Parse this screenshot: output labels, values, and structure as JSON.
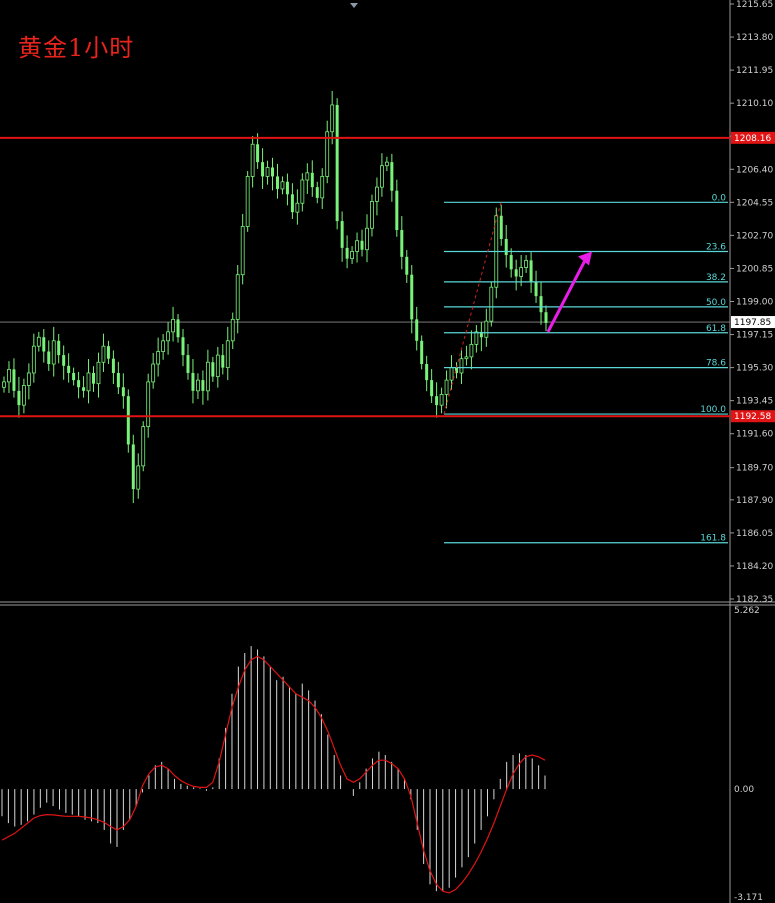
{
  "title": "黄金1小时",
  "colors": {
    "background": "#000000",
    "bull_candle": "#79f279",
    "bear_candle": "#79f279",
    "fib": "#5ad7d7",
    "support_resistance": "#e01414",
    "arrow": "#e81ee8",
    "macd_hist": "#d8d8d8",
    "signal": "#e01414",
    "axis_text": "#cfcfcf",
    "current_price_bg": "#ffffff"
  },
  "chart_data": [
    {
      "type": "candlestick",
      "title": "黄金1小时",
      "y_ticks": [
        "1215.65",
        "1213.80",
        "1211.95",
        "1210.10",
        "1208.25",
        "1206.40",
        "1204.55",
        "1202.70",
        "1200.85",
        "1199.00",
        "1197.15",
        "1195.30",
        "1193.45",
        "1191.60",
        "1189.70",
        "1187.90",
        "1186.05",
        "1184.20",
        "1182.35"
      ],
      "ylim": [
        1182.35,
        1215.65
      ],
      "horizontal_lines": [
        {
          "label": "1208.16",
          "value": 1208.16,
          "color": "red"
        },
        {
          "label": "1192.58",
          "value": 1192.58,
          "color": "red"
        }
      ],
      "current_price": {
        "label": "1197.85",
        "value": 1197.85
      },
      "fibonacci": {
        "levels": [
          {
            "label": "0.0",
            "value": 1204.55
          },
          {
            "label": "23.6",
            "value": 1201.8
          },
          {
            "label": "38.2",
            "value": 1200.1
          },
          {
            "label": "50.0",
            "value": 1198.7
          },
          {
            "label": "61.8",
            "value": 1197.25
          },
          {
            "label": "78.6",
            "value": 1195.3
          },
          {
            "label": "100.0",
            "value": 1192.7
          },
          {
            "label": "161.8",
            "value": 1185.5
          }
        ]
      },
      "arrow": {
        "from": [
          548,
          1197.3
        ],
        "to": [
          592,
          1201.8
        ],
        "direction": "up"
      },
      "closes": [
        1194.5,
        1195.2,
        1194.0,
        1193.2,
        1194.3,
        1195.0,
        1196.5,
        1197.0,
        1196.2,
        1195.5,
        1196.8,
        1196.0,
        1195.4,
        1195.0,
        1194.6,
        1194.2,
        1194.0,
        1195.0,
        1194.4,
        1195.6,
        1196.5,
        1195.8,
        1195.0,
        1194.2,
        1193.7,
        1191.0,
        1188.5,
        1189.8,
        1192.0,
        1194.5,
        1195.5,
        1196.2,
        1196.8,
        1197.3,
        1198.0,
        1197.0,
        1196.0,
        1195.0,
        1194.0,
        1194.6,
        1194.0,
        1195.6,
        1194.8,
        1196.0,
        1195.3,
        1196.8,
        1198.0,
        1200.5,
        1203.2,
        1206.0,
        1207.8,
        1206.8,
        1206.0,
        1206.5,
        1206.0,
        1205.3,
        1205.7,
        1205.0,
        1204.0,
        1204.5,
        1205.8,
        1206.2,
        1205.4,
        1204.8,
        1206.0,
        1208.5,
        1210.0,
        1203.5,
        1202.0,
        1201.4,
        1201.8,
        1202.4,
        1201.9,
        1203.1,
        1204.6,
        1205.4,
        1206.6,
        1206.8,
        1205.2,
        1203.0,
        1201.5,
        1200.5,
        1198.0,
        1196.8,
        1195.5,
        1194.6,
        1193.7,
        1193.2,
        1193.8,
        1194.6,
        1195.3,
        1195.0,
        1195.8,
        1195.9,
        1196.6,
        1197.3,
        1197.0,
        1197.9,
        1199.8,
        1203.8,
        1202.5,
        1201.6,
        1200.8,
        1200.4,
        1200.9,
        1201.3,
        1200.1,
        1199.3,
        1198.4,
        1197.8
      ]
    },
    {
      "type": "bar",
      "y_ticks": [
        "5.262",
        "0.00",
        "-3.171"
      ],
      "ylim": [
        -3.171,
        5.262
      ],
      "histogram": [
        -0.8,
        -1.0,
        -1.1,
        -1.05,
        -0.95,
        -0.75,
        -0.55,
        -0.4,
        -0.5,
        -0.6,
        -0.7,
        -0.75,
        -0.8,
        -0.9,
        -0.95,
        -1.0,
        -1.2,
        -1.6,
        -1.7,
        -1.2,
        -0.9,
        -0.5,
        -0.1,
        0.4,
        0.7,
        0.8,
        0.6,
        0.3,
        0.15,
        0.1,
        0.05,
        0.02,
        -0.05,
        0.05,
        0.9,
        1.8,
        2.8,
        3.6,
        4.0,
        4.2,
        4.1,
        3.9,
        3.6,
        3.2,
        3.3,
        3.0,
        2.8,
        3.1,
        2.9,
        2.6,
        2.2,
        1.6,
        1.0,
        0.4,
        0.0,
        -0.2,
        0.2,
        0.6,
        0.9,
        1.1,
        1.0,
        0.8,
        0.6,
        0.3,
        -0.3,
        -1.2,
        -2.2,
        -2.8,
        -3.0,
        -3.0,
        -2.9,
        -2.6,
        -2.3,
        -2.0,
        -1.6,
        -1.2,
        -0.8,
        -0.3,
        0.3,
        0.8,
        1.0,
        1.05,
        1.0,
        0.9,
        0.7,
        0.4
      ],
      "signal": [
        -1.5,
        -1.4,
        -1.3,
        -1.15,
        -1.0,
        -0.85,
        -0.78,
        -0.75,
        -0.76,
        -0.78,
        -0.8,
        -0.8,
        -0.8,
        -0.82,
        -0.85,
        -0.9,
        -0.98,
        -1.1,
        -1.2,
        -1.1,
        -0.9,
        -0.5,
        0.1,
        0.45,
        0.65,
        0.7,
        0.6,
        0.4,
        0.25,
        0.15,
        0.08,
        0.05,
        0.05,
        0.2,
        0.8,
        1.6,
        2.4,
        3.0,
        3.5,
        3.8,
        3.9,
        3.8,
        3.6,
        3.4,
        3.2,
        3.0,
        2.8,
        2.7,
        2.6,
        2.4,
        2.1,
        1.7,
        1.2,
        0.7,
        0.3,
        0.2,
        0.3,
        0.5,
        0.7,
        0.85,
        0.85,
        0.75,
        0.6,
        0.3,
        -0.2,
        -1.0,
        -1.8,
        -2.4,
        -2.8,
        -3.0,
        -3.05,
        -2.95,
        -2.75,
        -2.5,
        -2.2,
        -1.85,
        -1.45,
        -1.0,
        -0.5,
        0.0,
        0.45,
        0.75,
        0.95,
        1.0,
        0.95,
        0.85
      ]
    }
  ]
}
